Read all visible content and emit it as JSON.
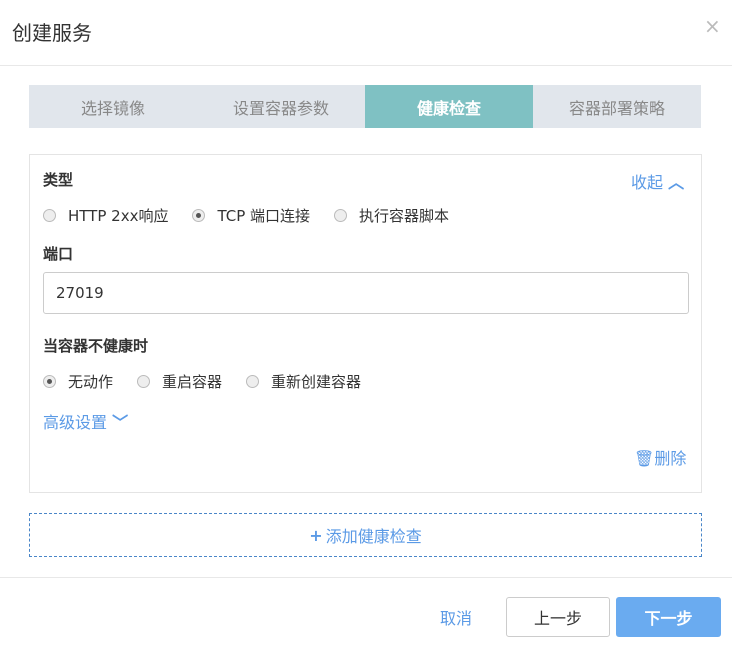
{
  "dialog": {
    "title": "创建服务",
    "close_icon": "×"
  },
  "steps": [
    "选择镜像",
    "设置容器参数",
    "健康检查",
    "容器部署策略"
  ],
  "active_step": 2,
  "card": {
    "type_label": "类型",
    "collapse": "收起",
    "type_options": [
      "HTTP 2xx响应",
      "TCP 端口连接",
      "执行容器脚本"
    ],
    "type_selected": 1,
    "port_label": "端口",
    "port_value": "27019",
    "unhealthy_label": "当容器不健康时",
    "unhealthy_options": [
      "无动作",
      "重启容器",
      "重新创建容器"
    ],
    "unhealthy_selected": 0,
    "advanced": "高级设置",
    "delete": "删除"
  },
  "add_label": "添加健康检查",
  "footer": {
    "cancel": "取消",
    "prev": "上一步",
    "next": "下一步"
  },
  "colors": {
    "accent": "#5b9ae6",
    "step_active": "#7fc1c3",
    "next_button": "#6aabf0"
  }
}
